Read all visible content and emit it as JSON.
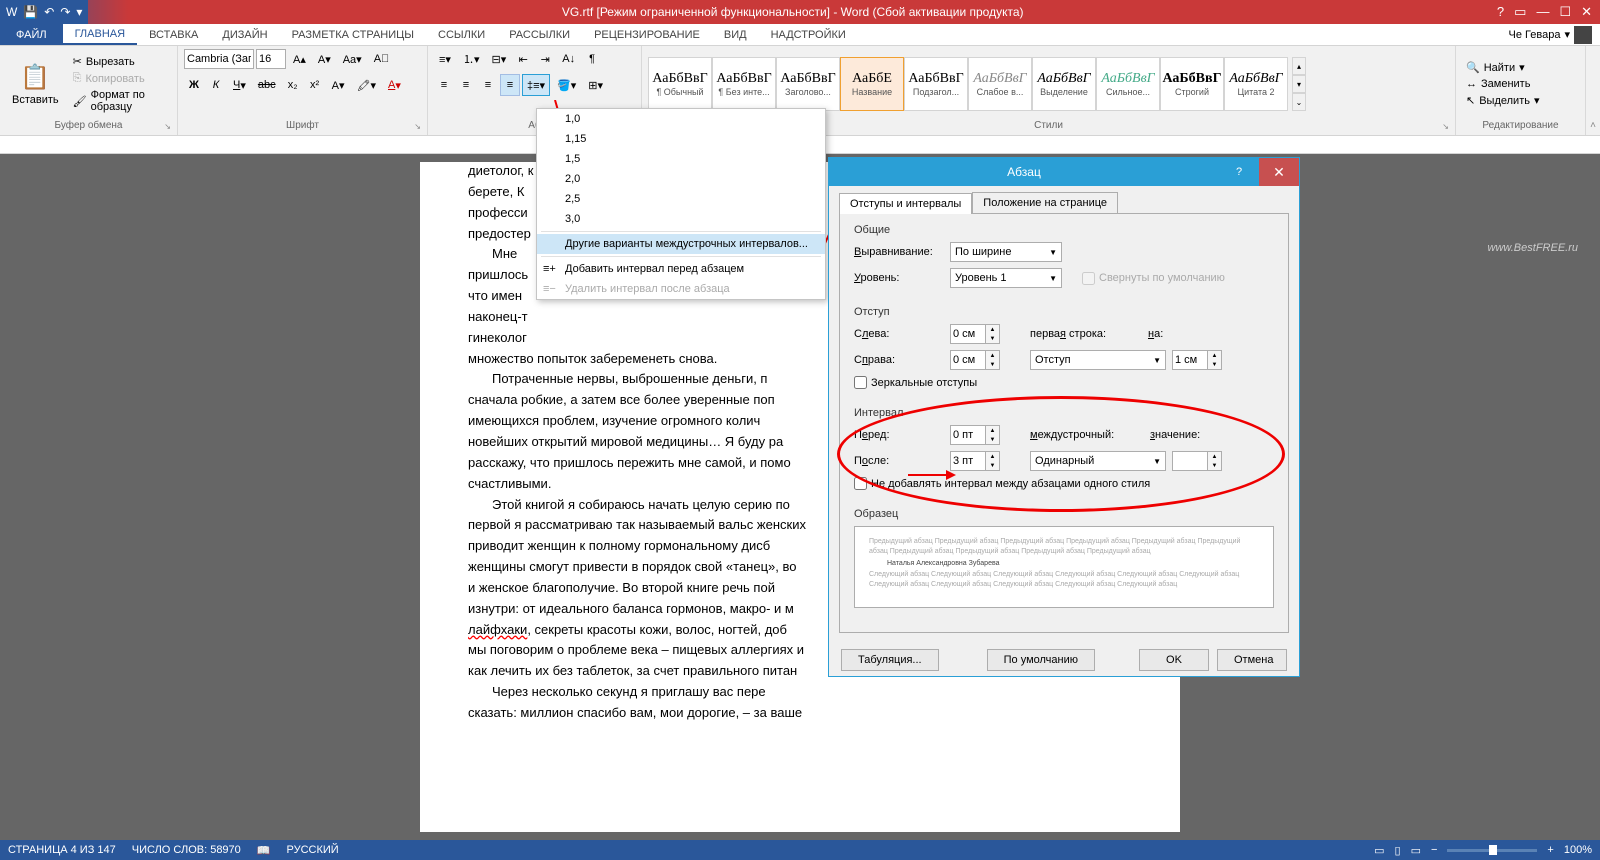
{
  "titlebar": {
    "title": "VG.rtf [Режим ограниченной функциональности] - Word (Сбой активации продукта)"
  },
  "tabs": {
    "file": "ФАЙЛ",
    "home": "ГЛАВНАЯ",
    "insert": "ВСТАВКА",
    "design": "ДИЗАЙН",
    "layout": "РАЗМЕТКА СТРАНИЦЫ",
    "refs": "ССЫЛКИ",
    "mail": "РАССЫЛКИ",
    "review": "РЕЦЕНЗИРОВАНИЕ",
    "view": "ВИД",
    "addins": "НАДСТРОЙКИ",
    "user": "Че Гевара"
  },
  "ribbon": {
    "clipboard": {
      "paste": "Вставить",
      "cut": "Вырезать",
      "copy": "Копировать",
      "format": "Формат по образцу",
      "label": "Буфер обмена"
    },
    "font": {
      "family": "Cambria (Заг",
      "size": "16",
      "label": "Шрифт"
    },
    "para": {
      "label": "Аб"
    },
    "styles": {
      "label": "Стили",
      "items": [
        {
          "sample": "АаБбВвГ",
          "name": "¶ Обычный"
        },
        {
          "sample": "АаБбВвГ",
          "name": "¶ Без инте..."
        },
        {
          "sample": "АаБбВвГ",
          "name": "Заголово..."
        },
        {
          "sample": "АаБбЕ",
          "name": "Название",
          "active": true
        },
        {
          "sample": "АаБбВвГ",
          "name": "Подзагол..."
        },
        {
          "sample": "АаБбВвГ",
          "name": "Слабое в...",
          "italic": true,
          "gray": true
        },
        {
          "sample": "АаБбВвГ",
          "name": "Выделение",
          "italic": true
        },
        {
          "sample": "АаБбВвГ",
          "name": "Сильное...",
          "italic": true,
          "blue": true
        },
        {
          "sample": "АаБбВвГ",
          "name": "Строгий",
          "bold": true
        },
        {
          "sample": "АаБбВвГ",
          "name": "Цитата 2",
          "italic": true
        }
      ]
    },
    "editing": {
      "find": "Найти",
      "replace": "Заменить",
      "select": "Выделить",
      "label": "Редактирование"
    }
  },
  "lsdrop": {
    "items": [
      "1,0",
      "1,15",
      "1,5",
      "2,0",
      "2,5",
      "3,0"
    ],
    "other": "Другие варианты междустрочных интервалов...",
    "addbefore": "Добавить интервал перед абзацем",
    "removeafter": "Удалить интервал после абзаца"
  },
  "dialog": {
    "title": "Абзац",
    "tab1": "Отступы и интервалы",
    "tab2": "Положение на странице",
    "general": "Общие",
    "align_l": "Выравнивание:",
    "align_v": "По ширине",
    "level_l": "Уровень:",
    "level_v": "Уровень 1",
    "collapse": "Свернуты по умолчанию",
    "indent": "Отступ",
    "left_l": "Слева:",
    "left_v": "0 см",
    "right_l": "Справа:",
    "right_v": "0 см",
    "first_l": "первая строка:",
    "first_v": "Отступ",
    "by_l": "на:",
    "by_v": "1 см",
    "mirror": "Зеркальные отступы",
    "spacing": "Интервал",
    "before_l": "Перед:",
    "before_v": "0 пт",
    "after_l": "После:",
    "after_v": "3 пт",
    "linesp_l": "междустрочный:",
    "linesp_v": "Одинарный",
    "at_l": "значение:",
    "at_v": "",
    "nosame": "Не добавлять интервал между абзацами одного стиля",
    "preview": "Образец",
    "preview_txt1": "Предыдущий абзац Предыдущий абзац Предыдущий абзац Предыдущий абзац Предыдущий абзац Предыдущий абзац Предыдущий абзац Предыдущий абзац Предыдущий абзац Предыдущий абзац",
    "preview_txt2": "Наталья Александровна Зубарева",
    "preview_txt3": "Следующий абзац Следующий абзац Следующий абзац Следующий абзац Следующий абзац Следующий абзац Следующий абзац Следующий абзац Следующий абзац Следующий абзац Следующий абзац",
    "tabs_btn": "Табуляция...",
    "default_btn": "По умолчанию",
    "ok": "OK",
    "cancel": "Отмена"
  },
  "doc": {
    "p1": "диетолог, к",
    "p2": "берете, К",
    "p3": "професси",
    "p4": "предостер",
    "p5": "Мне",
    "p6": "пришлось",
    "p7": "что имен",
    "p8": "наконец-т",
    "p9": "гинеколог",
    "p10": "множество попыток забеременеть снова.",
    "p11": "Потраченные нервы, выброшенные деньги, п",
    "p12": "сначала робкие, а затем все более уверенные поп",
    "p13": "имеющихся проблем, изучение огромного колич",
    "p14": "новейших открытий мировой медицины… Я буду ра",
    "p15": "расскажу, что пришлось пережить мне самой, и помо",
    "p16": "счастливыми.",
    "p17": "Этой книгой я собираюсь начать целую серию по",
    "p18": "первой я рассматриваю так называемый вальс женских",
    "p19": "приводит женщин к полному гормональному дисб",
    "p20": "женщины смогут привести в порядок свой «танец», во",
    "p21": "и женское благополучие. Во второй книге речь пой",
    "p22": "изнутри: от идеального баланса гормонов, макро- и м",
    "p23_a": "лайфхаки",
    "p23_b": ", секреты красоты кожи, волос, ногтей, доб",
    "p24": "мы поговорим о проблеме века – пищевых аллергиях и",
    "p25": "как лечить их без таблеток, за счет правильного питан",
    "p26": "Через несколько секунд я приглашу вас пере",
    "p27": "сказать: миллион спасибо вам, мои дорогие, – за ваше"
  },
  "status": {
    "page": "СТРАНИЦА 4 ИЗ 147",
    "words": "ЧИСЛО СЛОВ: 58970",
    "lang": "РУССКИЙ",
    "zoom": "100%"
  },
  "watermark": "www.BestFREE.ru"
}
